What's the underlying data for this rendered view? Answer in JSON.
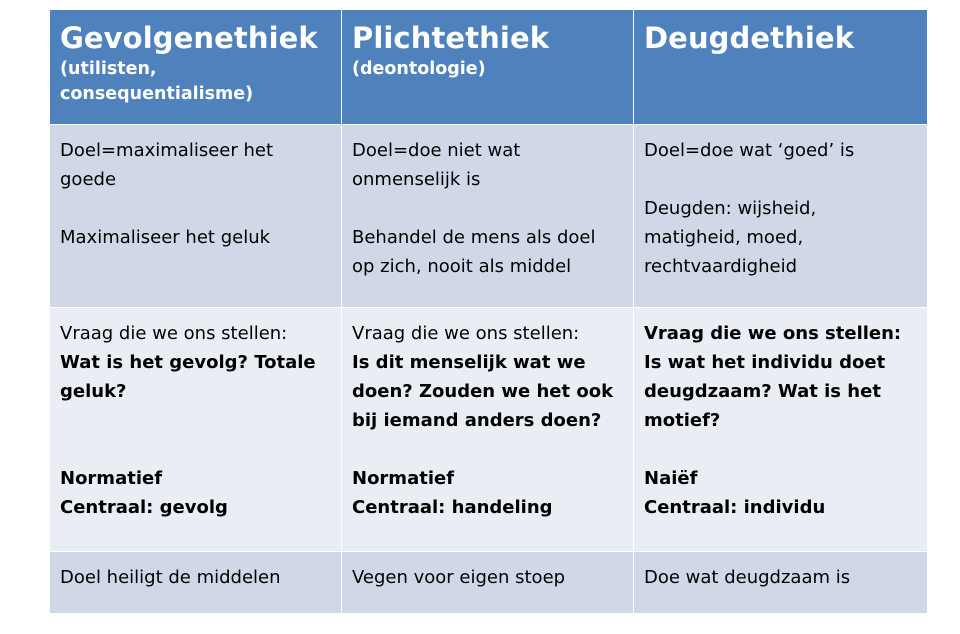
{
  "table": {
    "headers": [
      {
        "title": "Gevolgenethiek",
        "subtitle": "(utilisten, consequentialisme)"
      },
      {
        "title": "Plichtethiek",
        "subtitle": "(deontologie)"
      },
      {
        "title": "Deugdethiek",
        "subtitle": ""
      }
    ],
    "rows": [
      {
        "cells": [
          {
            "line1": "Doel=maximaliseer het goede",
            "line2": "Maximaliseer het geluk"
          },
          {
            "line1": "Doel=doe niet wat onmenselijk is",
            "line2": "Behandel de mens als doel op zich, nooit als middel"
          },
          {
            "line1": "Doel=doe wat ‘goed’ is",
            "line2": "Deugden: wijsheid, matigheid, moed, rechtvaardigheid"
          }
        ]
      },
      {
        "cells": [
          {
            "intro": "Vraag die we ons stellen:",
            "question": "Wat is het gevolg? Totale geluk?",
            "type": "Normatief",
            "central": "Centraal: gevolg"
          },
          {
            "intro": "Vraag die we ons stellen:",
            "question": "Is dit menselijk wat we doen? Zouden we het ook bij iemand anders doen?",
            "type": "Normatief",
            "central": "Centraal: handeling"
          },
          {
            "intro": "Vraag die we ons stellen:",
            "question": "Is wat het individu doet deugdzaam? Wat is het motief?",
            "type": "Naiëf",
            "central": "Centraal: individu"
          }
        ]
      },
      {
        "cells": [
          {
            "text": "Doel heiligt de middelen"
          },
          {
            "text": "Vegen voor eigen stoep"
          },
          {
            "text": "Doe wat deugdzaam is"
          }
        ]
      }
    ]
  },
  "colors": {
    "header_bg": "#4f81bd",
    "row_dark": "#d0d8e8",
    "row_light": "#e9edf4"
  }
}
